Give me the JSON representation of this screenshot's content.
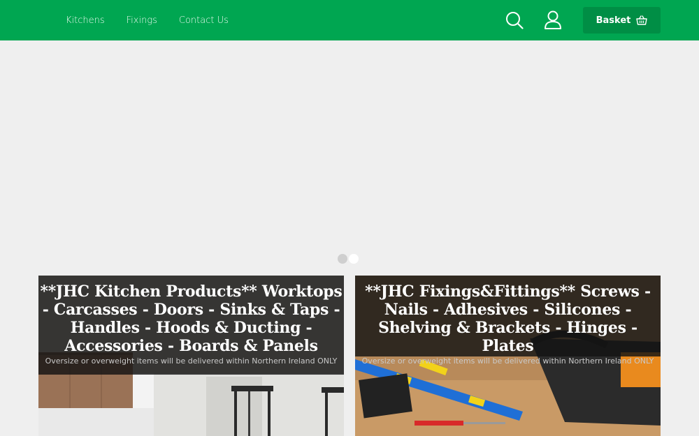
{
  "nav": {
    "items": [
      {
        "label": "Kitchens"
      },
      {
        "label": "Fixings"
      },
      {
        "label": "Contact Us"
      }
    ]
  },
  "header": {
    "basket_label": "Basket",
    "icons": [
      "search-icon",
      "user-icon",
      "basket-icon"
    ]
  },
  "colors": {
    "brand_green": "#00a651",
    "basket_green": "#008e45",
    "background": "#efefef"
  },
  "slider": {
    "dots": 2,
    "active_index": 0
  },
  "cards": [
    {
      "title": "**JHC Kitchen Products** Worktops - Carcasses - Doors - Sinks & Taps - Handles - Hoods & Ducting - Accessories - Boards & Panels",
      "subtitle": "Oversize or overweight items will be delivered within Northern Ireland ONLY"
    },
    {
      "title": "**JHC Fixings&Fittings** Screws - Nails - Adhesives - Silicones - Shelving & Brackets - Hinges - Plates",
      "subtitle": "Oversize or overweight items will be delivered within Northern Ireland ONLY"
    }
  ]
}
